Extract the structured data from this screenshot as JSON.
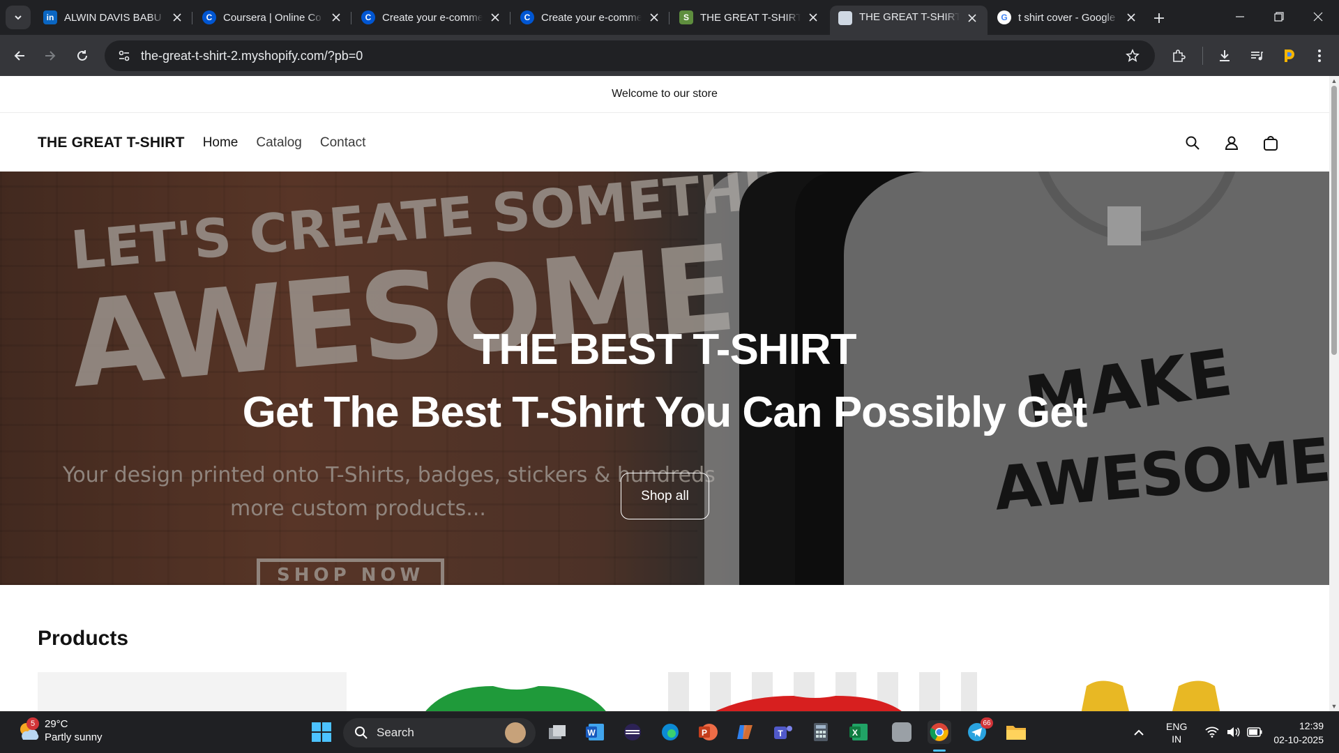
{
  "browser": {
    "tabs": [
      {
        "title": "ALWIN DAVIS BABU |",
        "favicon": "linkedin-icon"
      },
      {
        "title": "Coursera | Online Co",
        "favicon": "coursera-icon"
      },
      {
        "title": "Create your e-comme",
        "favicon": "coursera-icon"
      },
      {
        "title": "Create your e-comme",
        "favicon": "coursera-icon"
      },
      {
        "title": "THE GREAT T-SHIRT -",
        "favicon": "shopify-icon"
      },
      {
        "title": "THE GREAT T-SHIRT",
        "favicon": "page-icon",
        "active": true
      },
      {
        "title": "t shirt cover - Google",
        "favicon": "google-icon"
      }
    ],
    "url": "the-great-t-shirt-2.myshopify.com/?pb=0"
  },
  "store": {
    "announcement": "Welcome to our store",
    "logo": "THE GREAT T-SHIRT",
    "nav": [
      "Home",
      "Catalog",
      "Contact"
    ],
    "hero": {
      "heading": "THE BEST T-SHIRT",
      "subheading": "Get The Best T-Shirt You Can Possibly Get",
      "button": "Shop all",
      "image_text": {
        "line1": "LET'S CREATE SOMETHING",
        "line2": "AWESOME",
        "line3": "Your design printed onto T-Shirts, badges, stickers & hundreds",
        "line4": "more custom products...",
        "line5": "SHOP NOW",
        "shirt1": "MAKE",
        "shirt2": "AWESOME"
      }
    },
    "products_title": "Products"
  },
  "taskbar": {
    "weather": {
      "temp": "29°C",
      "condition": "Partly sunny",
      "badge": "5"
    },
    "search_placeholder": "Search",
    "telegram_badge": "66",
    "lang": {
      "line1": "ENG",
      "line2": "IN"
    },
    "time": "12:39",
    "date": "02-10-2025"
  },
  "colors": {
    "chrome_dark": "#202124",
    "chrome_toolbar": "#35363a",
    "page_bg": "#ffffff",
    "text_dark": "#121212"
  }
}
